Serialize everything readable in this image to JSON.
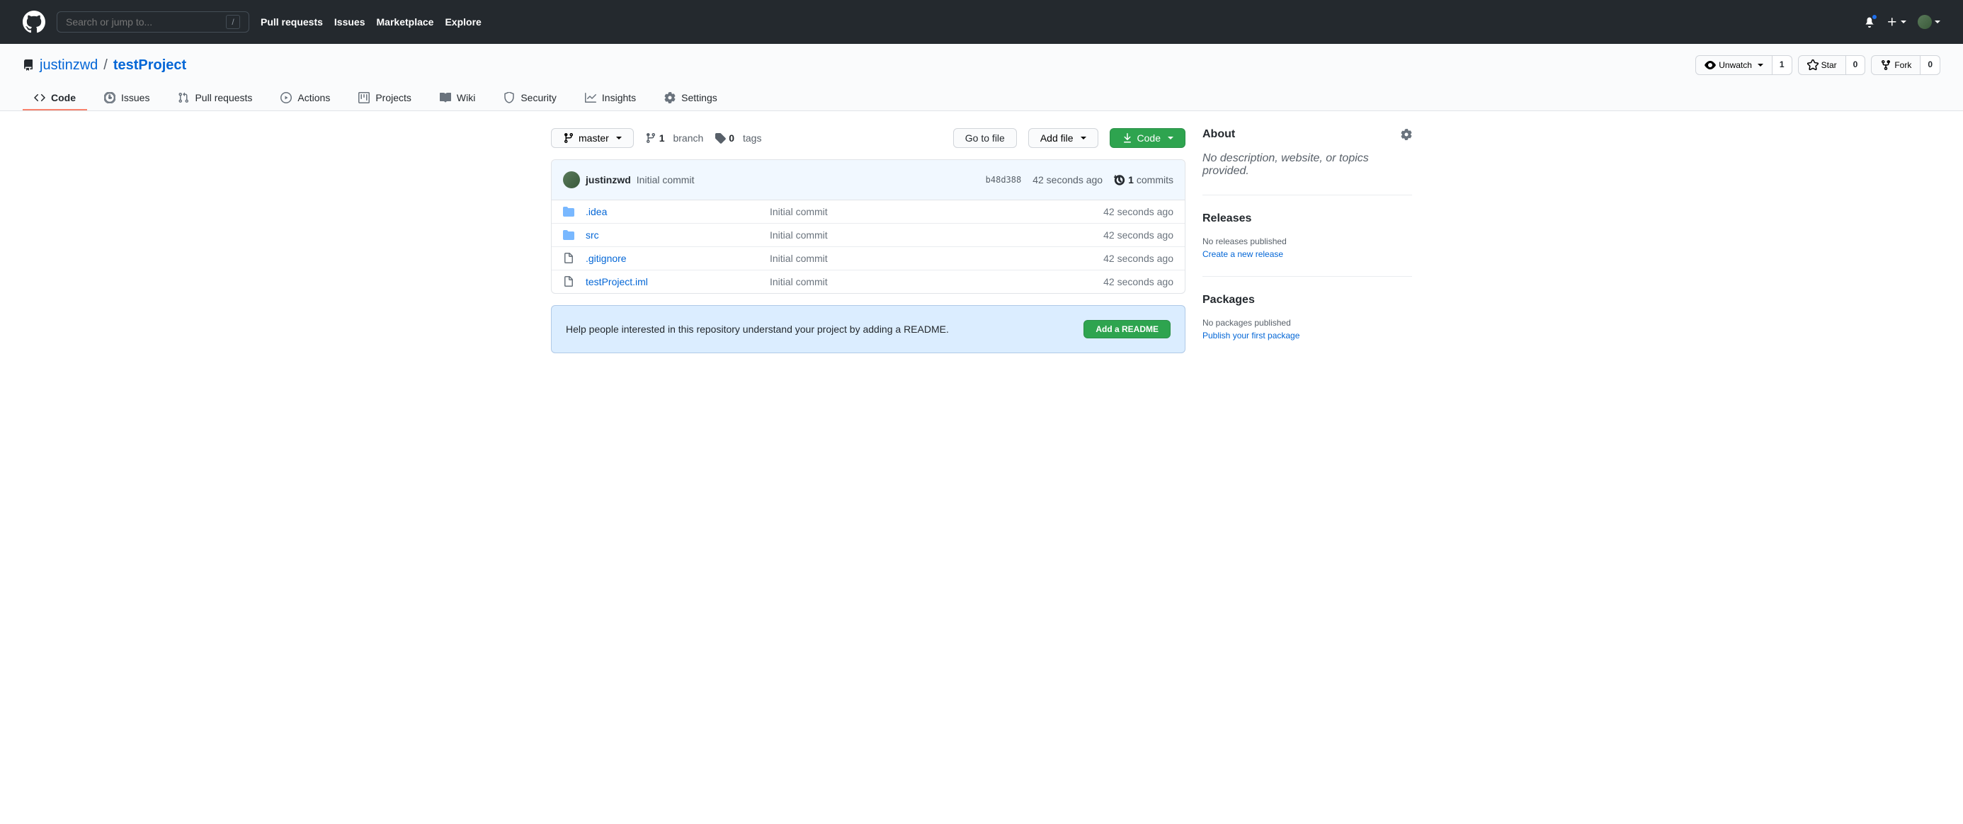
{
  "header": {
    "search_placeholder": "Search or jump to...",
    "nav": {
      "pull_requests": "Pull requests",
      "issues": "Issues",
      "marketplace": "Marketplace",
      "explore": "Explore"
    }
  },
  "repo": {
    "owner": "justinzwd",
    "name": "testProject",
    "actions": {
      "unwatch": "Unwatch",
      "watch_count": "1",
      "star": "Star",
      "star_count": "0",
      "fork": "Fork",
      "fork_count": "0"
    }
  },
  "tabs": {
    "code": "Code",
    "issues": "Issues",
    "pulls": "Pull requests",
    "actions": "Actions",
    "projects": "Projects",
    "wiki": "Wiki",
    "security": "Security",
    "insights": "Insights",
    "settings": "Settings"
  },
  "file_nav": {
    "branch": "master",
    "branch_count": "1",
    "branch_label": "branch",
    "tag_count": "0",
    "tag_label": "tags",
    "go_to_file": "Go to file",
    "add_file": "Add file",
    "code_btn": "Code"
  },
  "latest_commit": {
    "author": "justinzwd",
    "message": "Initial commit",
    "sha": "b48d388",
    "time": "42 seconds ago",
    "count": "1",
    "count_label": "commits"
  },
  "files": [
    {
      "type": "dir",
      "name": ".idea",
      "message": "Initial commit",
      "time": "42 seconds ago"
    },
    {
      "type": "dir",
      "name": "src",
      "message": "Initial commit",
      "time": "42 seconds ago"
    },
    {
      "type": "file",
      "name": ".gitignore",
      "message": "Initial commit",
      "time": "42 seconds ago"
    },
    {
      "type": "file",
      "name": "testProject.iml",
      "message": "Initial commit",
      "time": "42 seconds ago"
    }
  ],
  "readme_prompt": {
    "text": "Help people interested in this repository understand your project by adding a README.",
    "button": "Add a README"
  },
  "sidebar": {
    "about": {
      "title": "About",
      "description": "No description, website, or topics provided."
    },
    "releases": {
      "title": "Releases",
      "empty": "No releases published",
      "link": "Create a new release"
    },
    "packages": {
      "title": "Packages",
      "empty": "No packages published",
      "link": "Publish your first package"
    }
  }
}
